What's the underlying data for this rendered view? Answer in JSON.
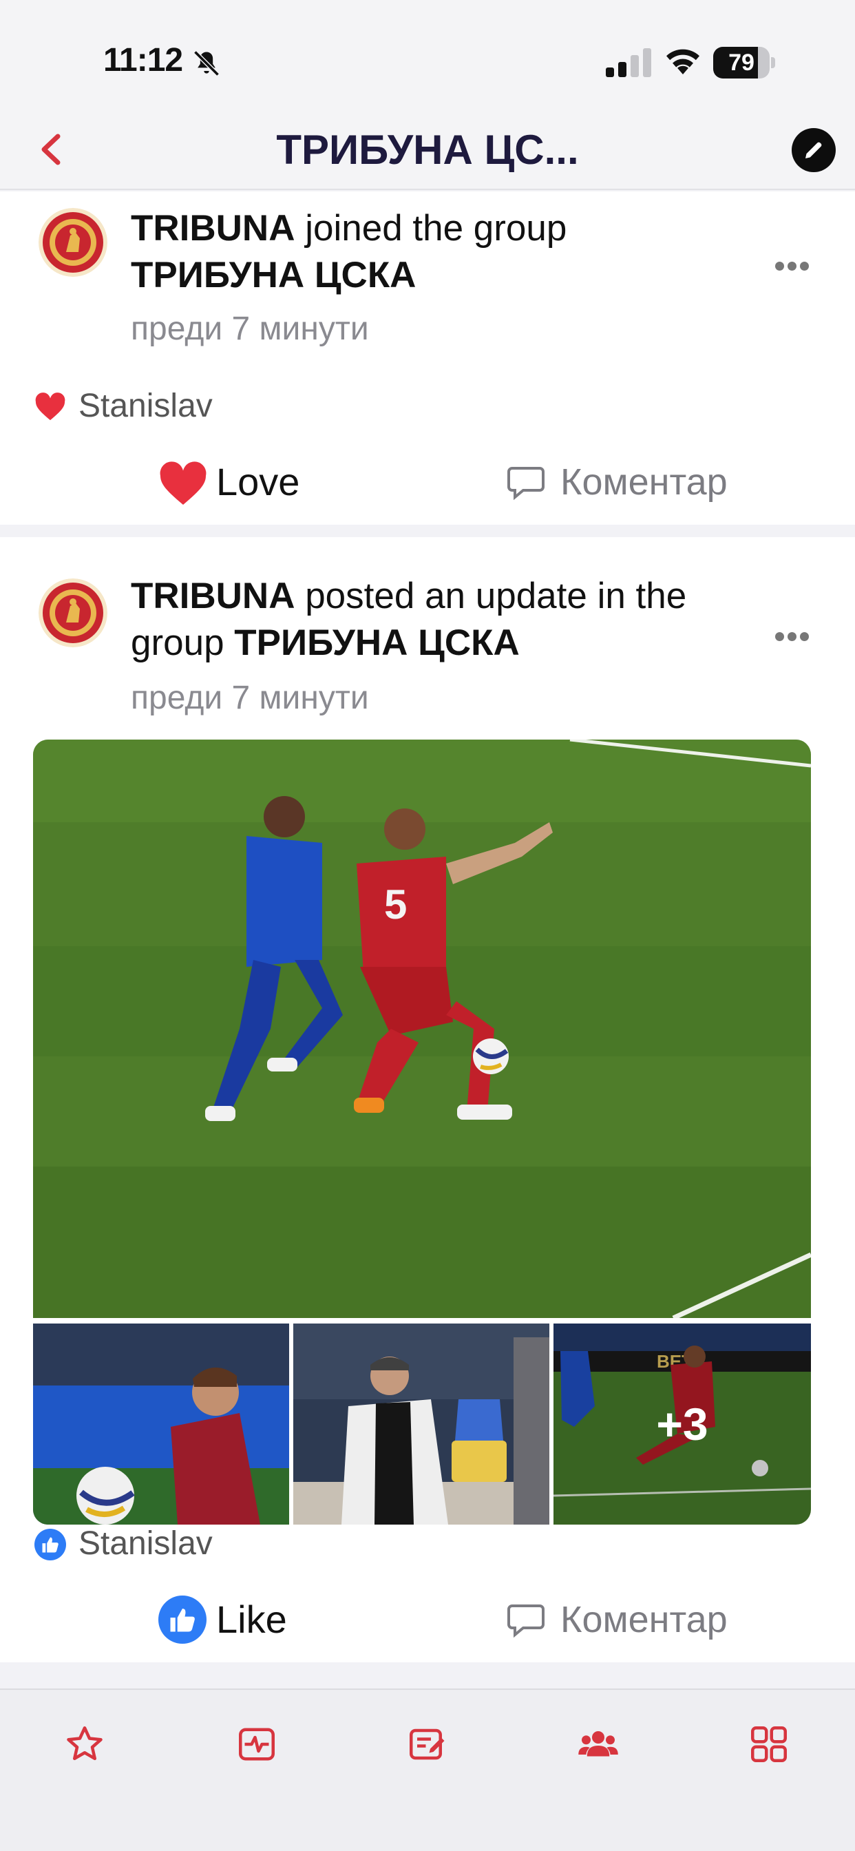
{
  "status_bar": {
    "time": "11:12",
    "battery_level": 79,
    "battery_label": "79"
  },
  "header": {
    "title": "ТРИБУНА ЦС..."
  },
  "colors": {
    "accent": "#d7353f",
    "love": "#e8303e",
    "like": "#2d7cf6",
    "title": "#1e1a3e"
  },
  "feed": [
    {
      "actor": "TRIBUNA",
      "action": " joined the group",
      "group": "ТРИБУНА ЦСКА",
      "time": "преди 7 минути",
      "reactor": "Stanislav",
      "reaction_icon": "heart-icon",
      "react_label": "Love",
      "comment_label": "Коментар"
    },
    {
      "actor": "TRIBUNA",
      "action": " posted an update in the group ",
      "group": "ТРИБУНА ЦСКА",
      "time": "преди 7 минути",
      "extra_photos": "+3",
      "reactor": "Stanislav",
      "reaction_icon": "thumbs-up-icon",
      "react_label": "Like",
      "comment_label": "Коментар"
    }
  ],
  "tabs": [
    {
      "icon": "star-icon"
    },
    {
      "icon": "activity-icon"
    },
    {
      "icon": "notes-icon"
    },
    {
      "icon": "groups-icon"
    },
    {
      "icon": "grid-icon"
    }
  ]
}
